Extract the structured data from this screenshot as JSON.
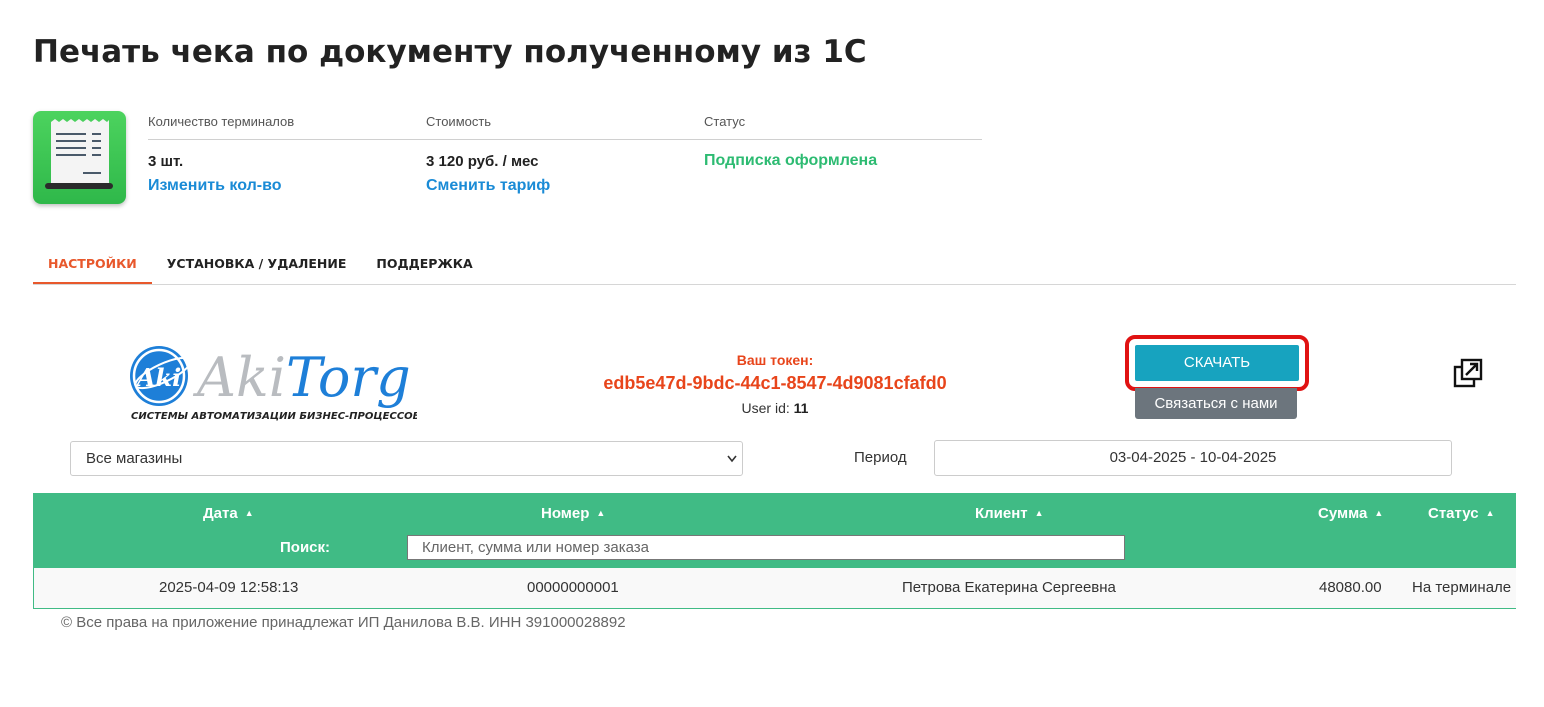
{
  "page": {
    "title": "Печать чека по документу полученному из 1С"
  },
  "info": {
    "terminals": {
      "label": "Количество терминалов",
      "value": "3 шт.",
      "link": "Изменить кол-во"
    },
    "price": {
      "label": "Стоимость",
      "value": "3 120 руб. / мес",
      "link": "Сменить тариф"
    },
    "status": {
      "label": "Статус",
      "value": "Подписка оформлена"
    }
  },
  "tabs": [
    {
      "label": "НАСТРОЙКИ",
      "active": true
    },
    {
      "label": "УСТАНОВКА / УДАЛЕНИЕ",
      "active": false
    },
    {
      "label": "ПОДДЕРЖКА",
      "active": false
    }
  ],
  "logo": {
    "mark": "Aki",
    "brand_part1": "Aki",
    "brand_part2": "Torg",
    "tagline": "СИСТЕМЫ АВТОМАТИЗАЦИИ БИЗНЕС-ПРОЦЕССОВ"
  },
  "token": {
    "label": "Ваш токен:",
    "value": "edb5e47d-9bdc-44c1-8547-4d9081cfafd0",
    "user_id_label": "User id:",
    "user_id": "11"
  },
  "buttons": {
    "download": "СКАЧАТЬ",
    "contact": "Связаться с нами"
  },
  "filters": {
    "store_selected": "Все магазины",
    "period_label": "Период",
    "period_value": "03-04-2025 - 10-04-2025"
  },
  "table": {
    "columns": [
      "Дата",
      "Номер",
      "Клиент",
      "Сумма",
      "Статус"
    ],
    "search_label": "Поиск:",
    "search_placeholder": "Клиент, сумма или номер заказа",
    "rows": [
      {
        "date": "2025-04-09 12:58:13",
        "number": "00000000001",
        "client": "Петрова Екатерина Сергеевна",
        "sum": "48080.00",
        "status": "На терминале"
      }
    ]
  },
  "footer": {
    "copyright": "© Все права на приложение принадлежат ИП Данилова В.В. ИНН 391000028892"
  },
  "colors": {
    "accent_orange": "#e8582c",
    "token_red": "#e8451b",
    "link_blue": "#1a8bd6",
    "status_green": "#2dbb72",
    "table_green": "#40bb85",
    "download_teal": "#17a3bf",
    "highlight_red": "#e01212"
  },
  "icons": {
    "app": "receipt-icon",
    "open_external": "open-in-new-icon",
    "select": "chevron-down-icon",
    "sort": "sort-up-icon"
  }
}
